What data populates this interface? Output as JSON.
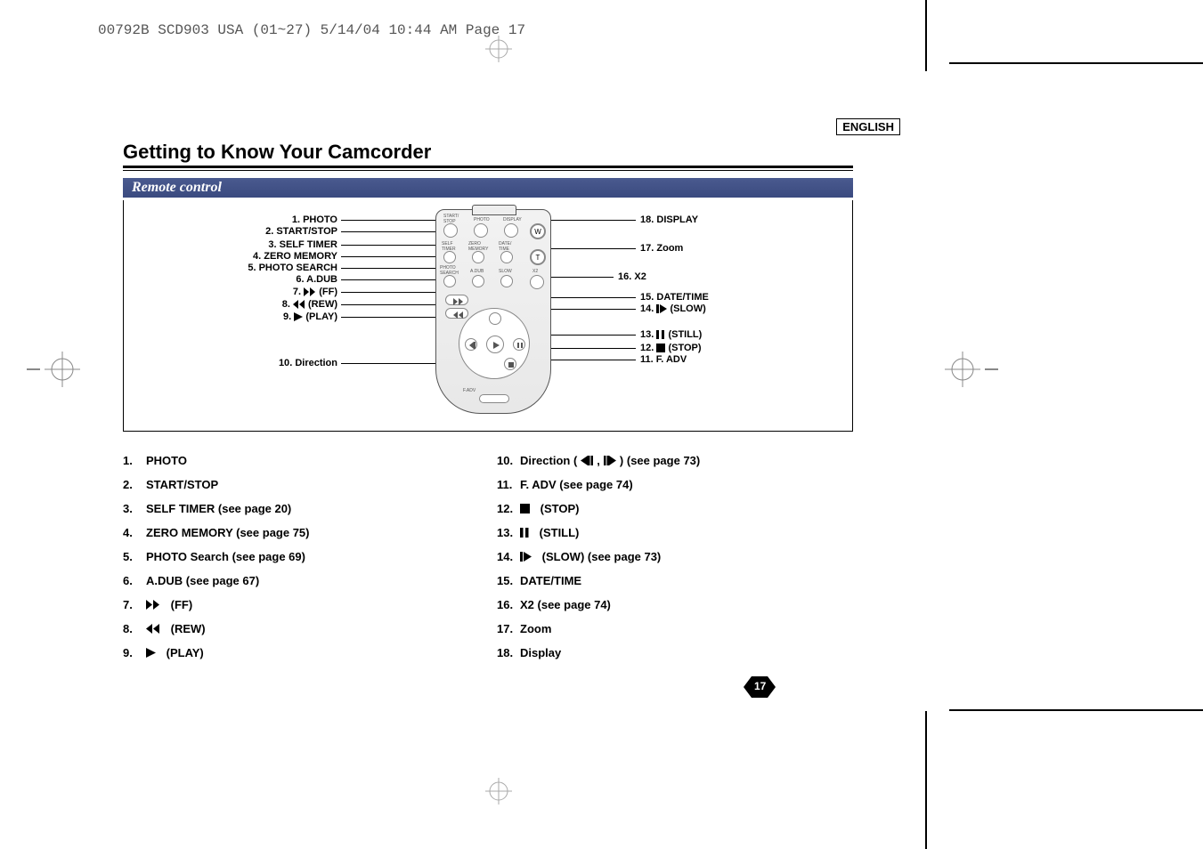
{
  "header_slug": "00792B SCD903 USA (01~27)  5/14/04 10:44 AM  Page 17",
  "language_label": "ENGLISH",
  "section_title": "Getting to Know Your Camcorder",
  "subsection_title": "Remote control",
  "page_number": "17",
  "callouts_left": [
    {
      "n": "1",
      "label": "PHOTO"
    },
    {
      "n": "2",
      "label": "START/STOP"
    },
    {
      "n": "3",
      "label": "SELF TIMER"
    },
    {
      "n": "4",
      "label": "ZERO MEMORY"
    },
    {
      "n": "5",
      "label": "PHOTO SEARCH"
    },
    {
      "n": "6",
      "label": "A.DUB"
    },
    {
      "n": "7",
      "label": "(FF)",
      "sym": "ff"
    },
    {
      "n": "8",
      "label": "(REW)",
      "sym": "rew"
    },
    {
      "n": "9",
      "label": "(PLAY)",
      "sym": "play"
    },
    {
      "n": "10",
      "label": "Direction"
    }
  ],
  "callouts_right": [
    {
      "n": "18",
      "label": "DISPLAY"
    },
    {
      "n": "17",
      "label": "Zoom"
    },
    {
      "n": "16",
      "label": "X2"
    },
    {
      "n": "15",
      "label": "DATE/TIME"
    },
    {
      "n": "14",
      "label": "(SLOW)",
      "sym": "slowfwd"
    },
    {
      "n": "13",
      "label": "(STILL)",
      "sym": "pause"
    },
    {
      "n": "12",
      "label": "(STOP)",
      "sym": "stop"
    },
    {
      "n": "11",
      "label": "F. ADV"
    }
  ],
  "list_left": [
    {
      "n": "1.",
      "text": "PHOTO"
    },
    {
      "n": "2.",
      "text": "START/STOP"
    },
    {
      "n": "3.",
      "text": "SELF TIMER (see page 20)"
    },
    {
      "n": "4.",
      "text": "ZERO MEMORY (see page 75)"
    },
    {
      "n": "5.",
      "text": "PHOTO Search (see page 69)"
    },
    {
      "n": "6.",
      "text": "A.DUB (see page 67)"
    },
    {
      "n": "7.",
      "text": "(FF)",
      "sym": "ff"
    },
    {
      "n": "8.",
      "text": "(REW)",
      "sym": "rew"
    },
    {
      "n": "9.",
      "text": "(PLAY)",
      "sym": "play"
    }
  ],
  "list_right": [
    {
      "n": "10.",
      "prefix": "Direction (",
      "mid_sym1": "stepback",
      "sep": " , ",
      "mid_sym2": "stepfwd",
      "suffix": " ) (see page 73)"
    },
    {
      "n": "11.",
      "text": " F. ADV (see page 74)"
    },
    {
      "n": "12.",
      "text": "(STOP)",
      "sym": "stop"
    },
    {
      "n": "13.",
      "text": "(STILL)",
      "sym": "pause"
    },
    {
      "n": "14.",
      "text": "(SLOW) (see page 73)",
      "sym": "slowfwd"
    },
    {
      "n": "15.",
      "text": "DATE/TIME"
    },
    {
      "n": "16.",
      "text": "X2 (see page 74)"
    },
    {
      "n": "17.",
      "text": "Zoom"
    },
    {
      "n": "18.",
      "text": "Display"
    }
  ],
  "remote_labels": {
    "start_stop": "START/\nSTOP",
    "photo": "PHOTO",
    "display": "DISPLAY",
    "self_timer": "SELF\nTIMER",
    "zero_memory": "ZERO\nMEMORY",
    "date_time": "DATE/\nTIME",
    "photo_search": "PHOTO\nSEARCH",
    "adub": "A.DUB",
    "slow": "SLOW",
    "x2": "X2",
    "w": "W",
    "t": "T",
    "fadv": "F.ADV"
  }
}
